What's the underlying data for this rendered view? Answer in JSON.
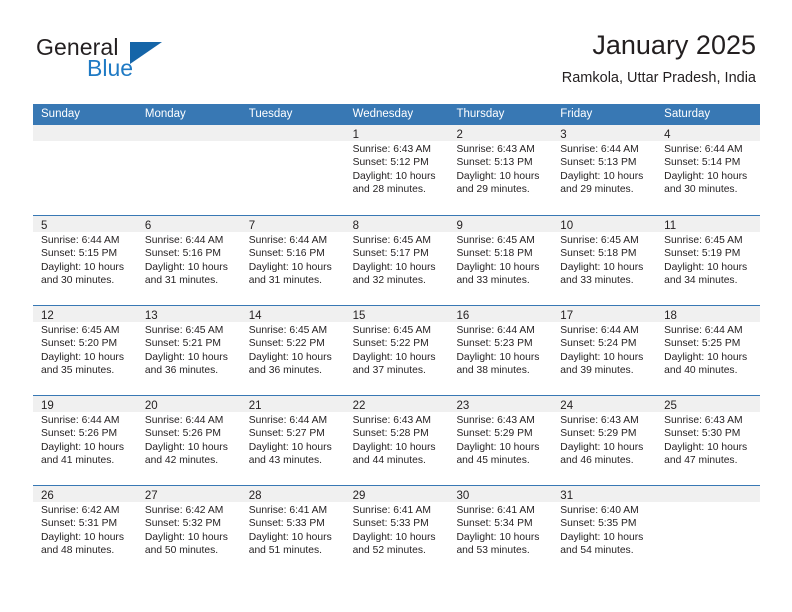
{
  "brand": {
    "word1": "General",
    "word2": "Blue",
    "logo_icon": "triangle-logo-icon",
    "accent_color": "#1565a8"
  },
  "header": {
    "title": "January 2025",
    "subtitle": "Ramkola, Uttar Pradesh, India"
  },
  "calendar": {
    "header_bg": "#3878b4",
    "daynum_band_bg": "#f0f0f0",
    "weekdays": [
      "Sunday",
      "Monday",
      "Tuesday",
      "Wednesday",
      "Thursday",
      "Friday",
      "Saturday"
    ],
    "weeks": [
      [
        {
          "day": "",
          "empty": true,
          "lines": []
        },
        {
          "day": "",
          "empty": true,
          "lines": []
        },
        {
          "day": "",
          "empty": true,
          "lines": []
        },
        {
          "day": "1",
          "empty": false,
          "lines": [
            "Sunrise: 6:43 AM",
            "Sunset: 5:12 PM",
            "Daylight: 10 hours",
            "and 28 minutes."
          ]
        },
        {
          "day": "2",
          "empty": false,
          "lines": [
            "Sunrise: 6:43 AM",
            "Sunset: 5:13 PM",
            "Daylight: 10 hours",
            "and 29 minutes."
          ]
        },
        {
          "day": "3",
          "empty": false,
          "lines": [
            "Sunrise: 6:44 AM",
            "Sunset: 5:13 PM",
            "Daylight: 10 hours",
            "and 29 minutes."
          ]
        },
        {
          "day": "4",
          "empty": false,
          "lines": [
            "Sunrise: 6:44 AM",
            "Sunset: 5:14 PM",
            "Daylight: 10 hours",
            "and 30 minutes."
          ]
        }
      ],
      [
        {
          "day": "5",
          "empty": false,
          "lines": [
            "Sunrise: 6:44 AM",
            "Sunset: 5:15 PM",
            "Daylight: 10 hours",
            "and 30 minutes."
          ]
        },
        {
          "day": "6",
          "empty": false,
          "lines": [
            "Sunrise: 6:44 AM",
            "Sunset: 5:16 PM",
            "Daylight: 10 hours",
            "and 31 minutes."
          ]
        },
        {
          "day": "7",
          "empty": false,
          "lines": [
            "Sunrise: 6:44 AM",
            "Sunset: 5:16 PM",
            "Daylight: 10 hours",
            "and 31 minutes."
          ]
        },
        {
          "day": "8",
          "empty": false,
          "lines": [
            "Sunrise: 6:45 AM",
            "Sunset: 5:17 PM",
            "Daylight: 10 hours",
            "and 32 minutes."
          ]
        },
        {
          "day": "9",
          "empty": false,
          "lines": [
            "Sunrise: 6:45 AM",
            "Sunset: 5:18 PM",
            "Daylight: 10 hours",
            "and 33 minutes."
          ]
        },
        {
          "day": "10",
          "empty": false,
          "lines": [
            "Sunrise: 6:45 AM",
            "Sunset: 5:18 PM",
            "Daylight: 10 hours",
            "and 33 minutes."
          ]
        },
        {
          "day": "11",
          "empty": false,
          "lines": [
            "Sunrise: 6:45 AM",
            "Sunset: 5:19 PM",
            "Daylight: 10 hours",
            "and 34 minutes."
          ]
        }
      ],
      [
        {
          "day": "12",
          "empty": false,
          "lines": [
            "Sunrise: 6:45 AM",
            "Sunset: 5:20 PM",
            "Daylight: 10 hours",
            "and 35 minutes."
          ]
        },
        {
          "day": "13",
          "empty": false,
          "lines": [
            "Sunrise: 6:45 AM",
            "Sunset: 5:21 PM",
            "Daylight: 10 hours",
            "and 36 minutes."
          ]
        },
        {
          "day": "14",
          "empty": false,
          "lines": [
            "Sunrise: 6:45 AM",
            "Sunset: 5:22 PM",
            "Daylight: 10 hours",
            "and 36 minutes."
          ]
        },
        {
          "day": "15",
          "empty": false,
          "lines": [
            "Sunrise: 6:45 AM",
            "Sunset: 5:22 PM",
            "Daylight: 10 hours",
            "and 37 minutes."
          ]
        },
        {
          "day": "16",
          "empty": false,
          "lines": [
            "Sunrise: 6:44 AM",
            "Sunset: 5:23 PM",
            "Daylight: 10 hours",
            "and 38 minutes."
          ]
        },
        {
          "day": "17",
          "empty": false,
          "lines": [
            "Sunrise: 6:44 AM",
            "Sunset: 5:24 PM",
            "Daylight: 10 hours",
            "and 39 minutes."
          ]
        },
        {
          "day": "18",
          "empty": false,
          "lines": [
            "Sunrise: 6:44 AM",
            "Sunset: 5:25 PM",
            "Daylight: 10 hours",
            "and 40 minutes."
          ]
        }
      ],
      [
        {
          "day": "19",
          "empty": false,
          "lines": [
            "Sunrise: 6:44 AM",
            "Sunset: 5:26 PM",
            "Daylight: 10 hours",
            "and 41 minutes."
          ]
        },
        {
          "day": "20",
          "empty": false,
          "lines": [
            "Sunrise: 6:44 AM",
            "Sunset: 5:26 PM",
            "Daylight: 10 hours",
            "and 42 minutes."
          ]
        },
        {
          "day": "21",
          "empty": false,
          "lines": [
            "Sunrise: 6:44 AM",
            "Sunset: 5:27 PM",
            "Daylight: 10 hours",
            "and 43 minutes."
          ]
        },
        {
          "day": "22",
          "empty": false,
          "lines": [
            "Sunrise: 6:43 AM",
            "Sunset: 5:28 PM",
            "Daylight: 10 hours",
            "and 44 minutes."
          ]
        },
        {
          "day": "23",
          "empty": false,
          "lines": [
            "Sunrise: 6:43 AM",
            "Sunset: 5:29 PM",
            "Daylight: 10 hours",
            "and 45 minutes."
          ]
        },
        {
          "day": "24",
          "empty": false,
          "lines": [
            "Sunrise: 6:43 AM",
            "Sunset: 5:29 PM",
            "Daylight: 10 hours",
            "and 46 minutes."
          ]
        },
        {
          "day": "25",
          "empty": false,
          "lines": [
            "Sunrise: 6:43 AM",
            "Sunset: 5:30 PM",
            "Daylight: 10 hours",
            "and 47 minutes."
          ]
        }
      ],
      [
        {
          "day": "26",
          "empty": false,
          "lines": [
            "Sunrise: 6:42 AM",
            "Sunset: 5:31 PM",
            "Daylight: 10 hours",
            "and 48 minutes."
          ]
        },
        {
          "day": "27",
          "empty": false,
          "lines": [
            "Sunrise: 6:42 AM",
            "Sunset: 5:32 PM",
            "Daylight: 10 hours",
            "and 50 minutes."
          ]
        },
        {
          "day": "28",
          "empty": false,
          "lines": [
            "Sunrise: 6:41 AM",
            "Sunset: 5:33 PM",
            "Daylight: 10 hours",
            "and 51 minutes."
          ]
        },
        {
          "day": "29",
          "empty": false,
          "lines": [
            "Sunrise: 6:41 AM",
            "Sunset: 5:33 PM",
            "Daylight: 10 hours",
            "and 52 minutes."
          ]
        },
        {
          "day": "30",
          "empty": false,
          "lines": [
            "Sunrise: 6:41 AM",
            "Sunset: 5:34 PM",
            "Daylight: 10 hours",
            "and 53 minutes."
          ]
        },
        {
          "day": "31",
          "empty": false,
          "lines": [
            "Sunrise: 6:40 AM",
            "Sunset: 5:35 PM",
            "Daylight: 10 hours",
            "and 54 minutes."
          ]
        },
        {
          "day": "",
          "empty": true,
          "lines": []
        }
      ]
    ]
  }
}
